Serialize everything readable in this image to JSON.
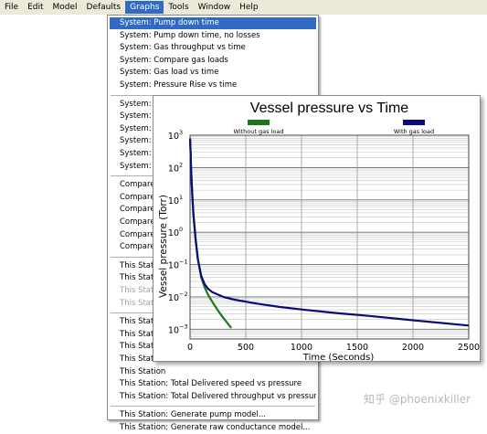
{
  "menubar": {
    "items": [
      "File",
      "Edit",
      "Model",
      "Defaults",
      "Graphs",
      "Tools",
      "Window",
      "Help"
    ],
    "active": "Graphs",
    "active_color": "#316ac5"
  },
  "dropdown": {
    "items": [
      {
        "label": "System: Pump down time",
        "state": "highlighted"
      },
      {
        "label": "System: Pump down time, no losses",
        "state": "normal"
      },
      {
        "label": "System: Gas throughput vs time",
        "state": "normal"
      },
      {
        "label": "System: Compare gas loads",
        "state": "normal"
      },
      {
        "label": "System: Gas load vs time",
        "state": "normal"
      },
      {
        "label": "System: Pressure Rise vs time",
        "state": "normal"
      },
      {
        "separator": true
      },
      {
        "label": "System: C",
        "state": "normal"
      },
      {
        "label": "System: Th",
        "state": "normal"
      },
      {
        "label": "System: Pu",
        "state": "normal"
      },
      {
        "label": "System: Pu",
        "state": "normal"
      },
      {
        "label": "System: D",
        "state": "normal"
      },
      {
        "label": "System: D",
        "state": "normal"
      },
      {
        "separator": true
      },
      {
        "label": "Compare s",
        "state": "normal"
      },
      {
        "label": "Compare s",
        "state": "normal"
      },
      {
        "label": "Compare s",
        "state": "normal"
      },
      {
        "label": "Compare s",
        "state": "normal"
      },
      {
        "label": "Compare s",
        "state": "normal"
      },
      {
        "label": "Compare s",
        "state": "normal"
      },
      {
        "separator": true
      },
      {
        "label": "This Station",
        "state": "normal"
      },
      {
        "label": "This Station",
        "state": "normal"
      },
      {
        "label": "This Station",
        "state": "disabled"
      },
      {
        "label": "This Station",
        "state": "disabled"
      },
      {
        "separator": true
      },
      {
        "label": "This Station",
        "state": "normal"
      },
      {
        "label": "This Station",
        "state": "normal"
      },
      {
        "label": "This Station",
        "state": "normal"
      },
      {
        "label": "This Station",
        "state": "normal"
      },
      {
        "label": "This Station",
        "state": "normal"
      },
      {
        "label": "This Station: Total Delivered speed vs pressure",
        "state": "normal"
      },
      {
        "label": "This Station: Total Delivered throughput vs pressure",
        "state": "normal"
      },
      {
        "separator": true
      },
      {
        "label": "This Station: Generate pump model...",
        "state": "normal"
      },
      {
        "label": "This Station: Generate raw conductance model...",
        "state": "normal"
      }
    ]
  },
  "chart_data": {
    "type": "line",
    "title": "Vessel pressure vs Time",
    "xlabel": "Time  (Seconds)",
    "ylabel": "Vessel pressure  (Torr)",
    "xlim": [
      0,
      2500
    ],
    "ylim": [
      0.0005,
      1000
    ],
    "yscale": "log",
    "grid": true,
    "legend_position": "top",
    "x_ticks": [
      "0",
      "500",
      "1000",
      "1500",
      "2000",
      "2500"
    ],
    "y_ticks": [
      {
        "base": "10",
        "exp": "3",
        "value": 1000
      },
      {
        "base": "10",
        "exp": "2",
        "value": 100
      },
      {
        "base": "10",
        "exp": "1",
        "value": 10
      },
      {
        "base": "10",
        "exp": "0",
        "value": 1
      },
      {
        "base": "10",
        "exp": "−1",
        "value": 0.1
      },
      {
        "base": "10",
        "exp": "−2",
        "value": 0.01
      },
      {
        "base": "10",
        "exp": "−3",
        "value": 0.001
      }
    ],
    "series": [
      {
        "name": "Without gas load",
        "color": "#1a7a1a",
        "x": [
          0,
          5,
          10,
          20,
          30,
          50,
          70,
          100,
          130,
          160,
          200,
          250,
          300,
          370
        ],
        "y": [
          800,
          300,
          80,
          15,
          3.5,
          0.6,
          0.15,
          0.04,
          0.02,
          0.012,
          0.007,
          0.0038,
          0.0022,
          0.0011
        ]
      },
      {
        "name": "With gas load",
        "color": "#0a0a78",
        "x": [
          0,
          5,
          10,
          20,
          30,
          50,
          70,
          100,
          130,
          160,
          200,
          300,
          400,
          600,
          800,
          1000,
          1300,
          1600,
          2000,
          2500
        ],
        "y": [
          800,
          300,
          80,
          15,
          3.5,
          0.6,
          0.15,
          0.045,
          0.025,
          0.018,
          0.014,
          0.01,
          0.0082,
          0.0062,
          0.0049,
          0.0041,
          0.0032,
          0.0026,
          0.0019,
          0.0013
        ]
      }
    ]
  },
  "watermark": "知乎 @phoenixkiller"
}
